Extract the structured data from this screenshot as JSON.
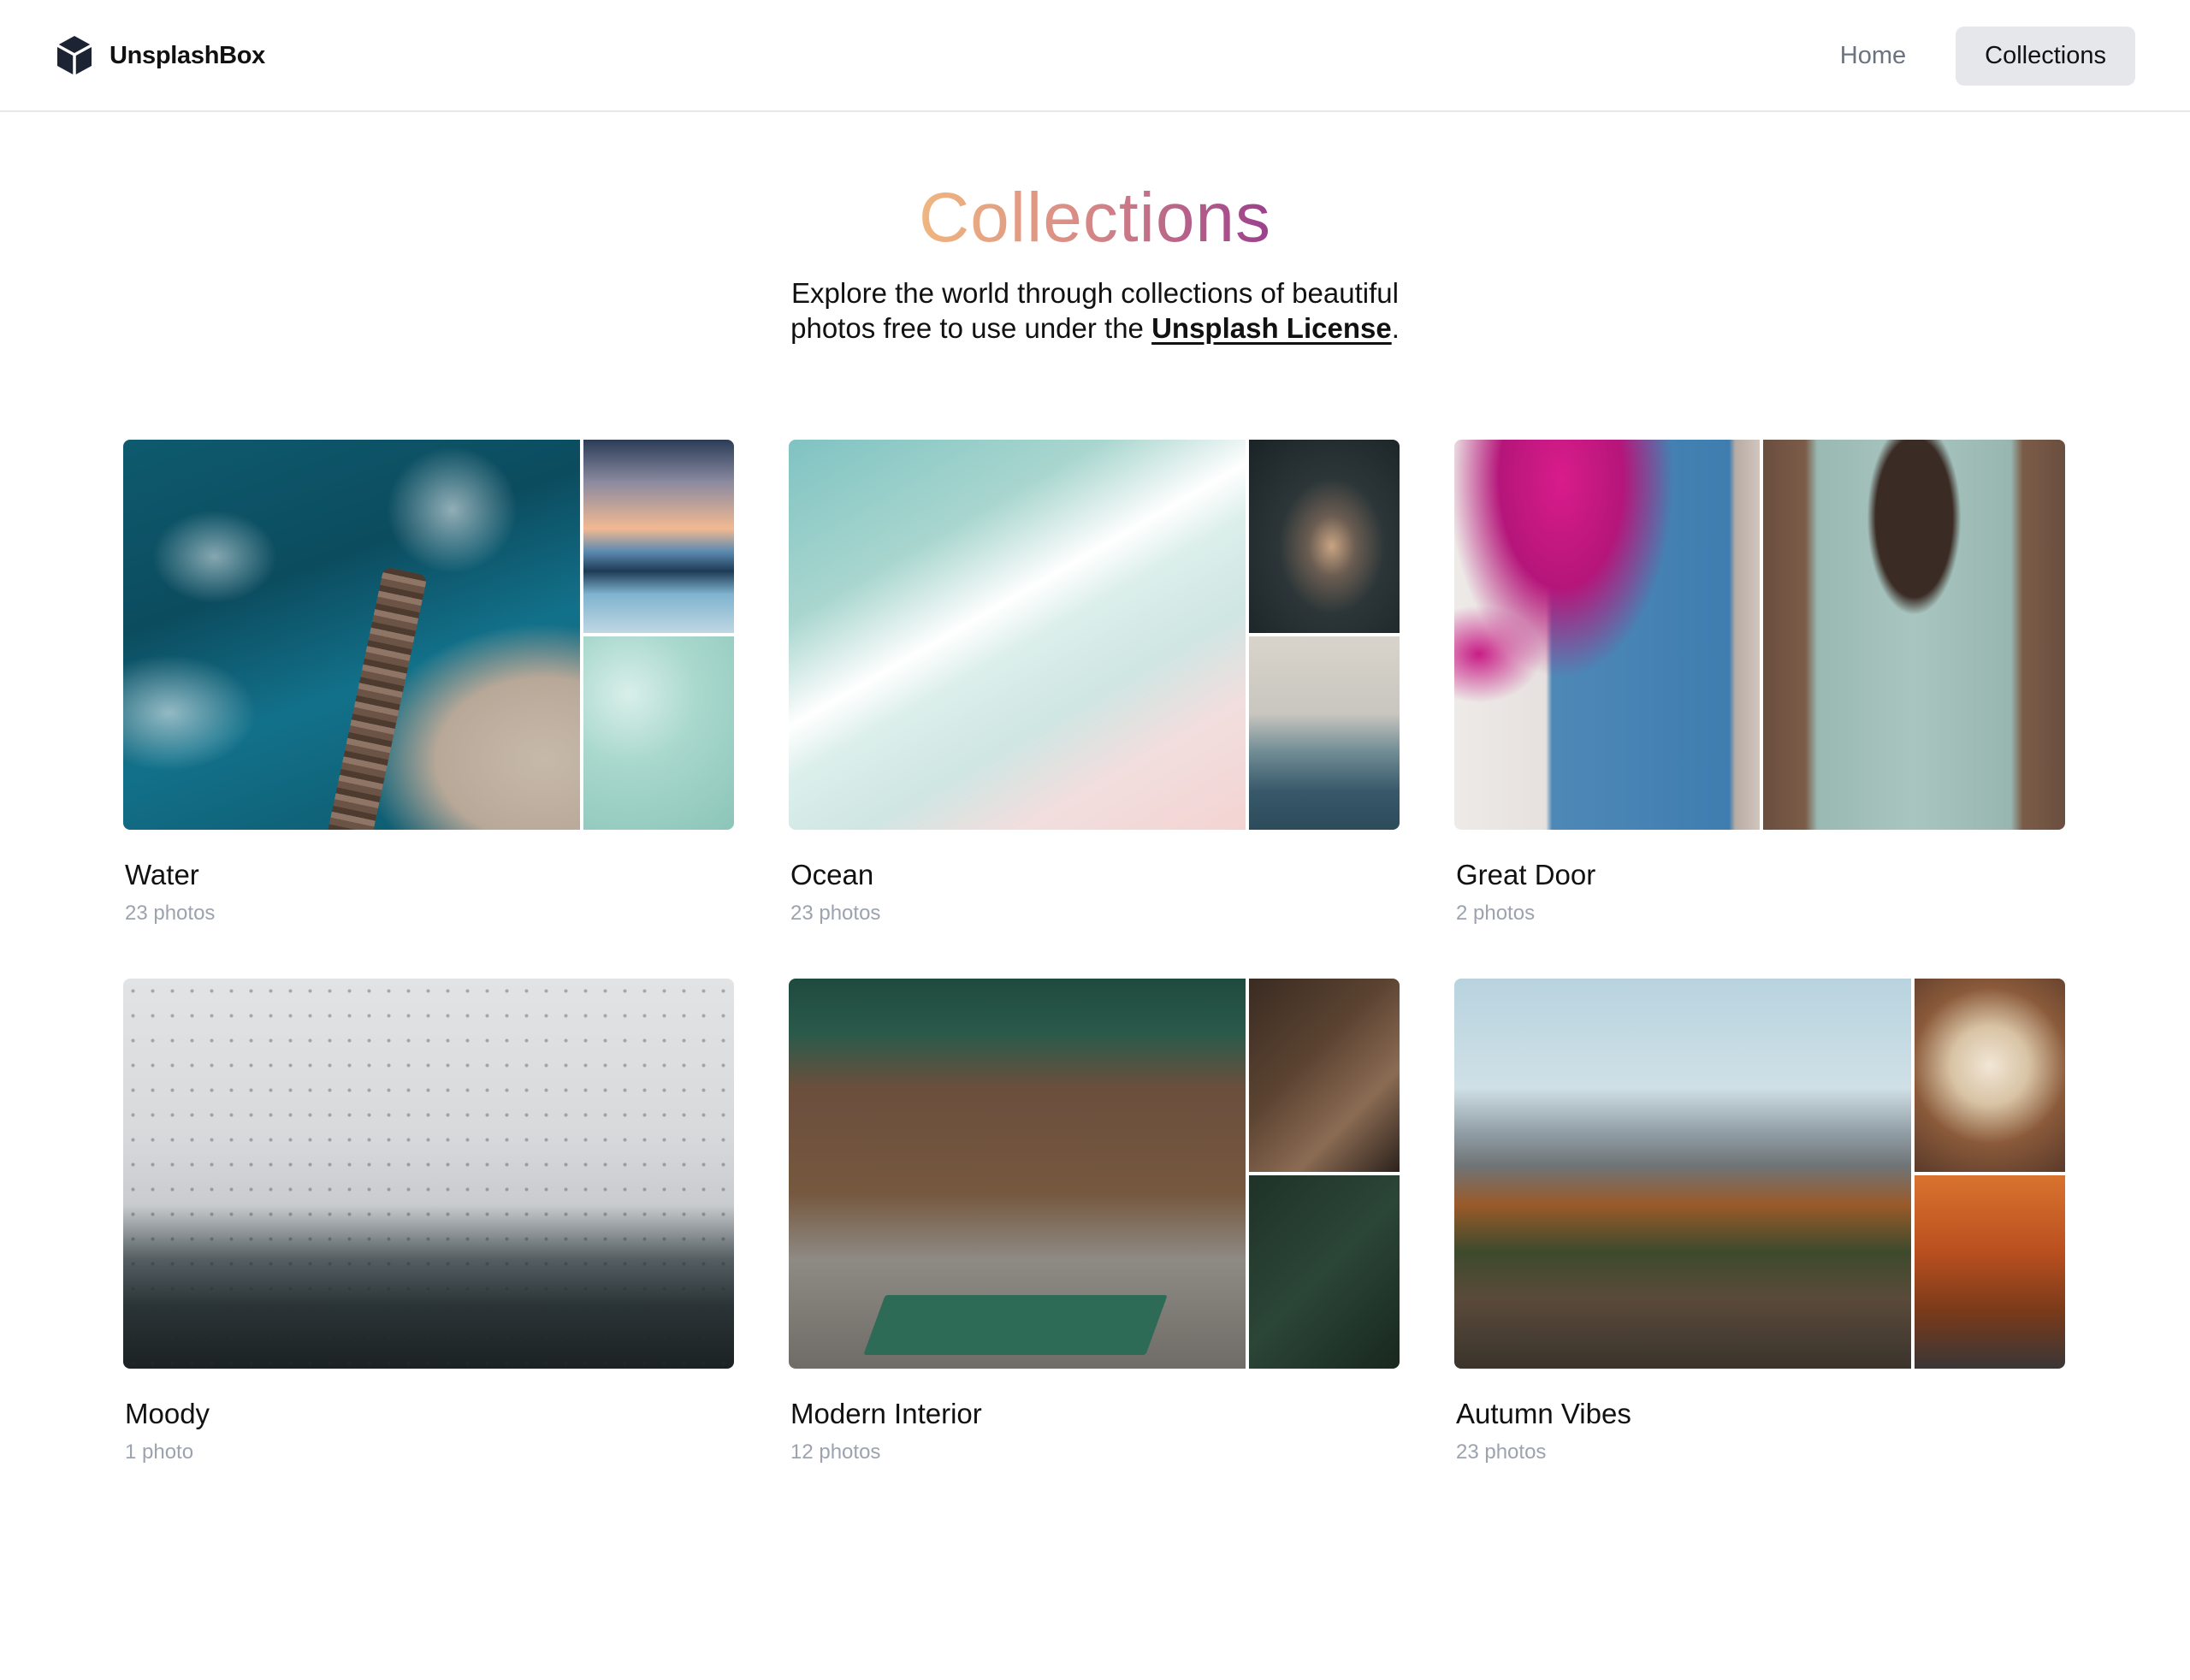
{
  "brand": {
    "name": "UnsplashBox"
  },
  "nav": {
    "home": "Home",
    "collections": "Collections"
  },
  "hero": {
    "title": "Collections",
    "subtitle_line1": "Explore the world through collections of beautiful",
    "subtitle_line2_pre": "photos free to use under the ",
    "license_link": "Unsplash License",
    "subtitle_line2_post": "."
  },
  "collections": [
    {
      "title": "Water",
      "count": "23 photos"
    },
    {
      "title": "Ocean",
      "count": "23 photos"
    },
    {
      "title": "Great Door",
      "count": "2 photos"
    },
    {
      "title": "Moody",
      "count": "1 photo"
    },
    {
      "title": "Modern Interior",
      "count": "12 photos"
    },
    {
      "title": "Autumn Vibes",
      "count": "23 photos"
    }
  ]
}
